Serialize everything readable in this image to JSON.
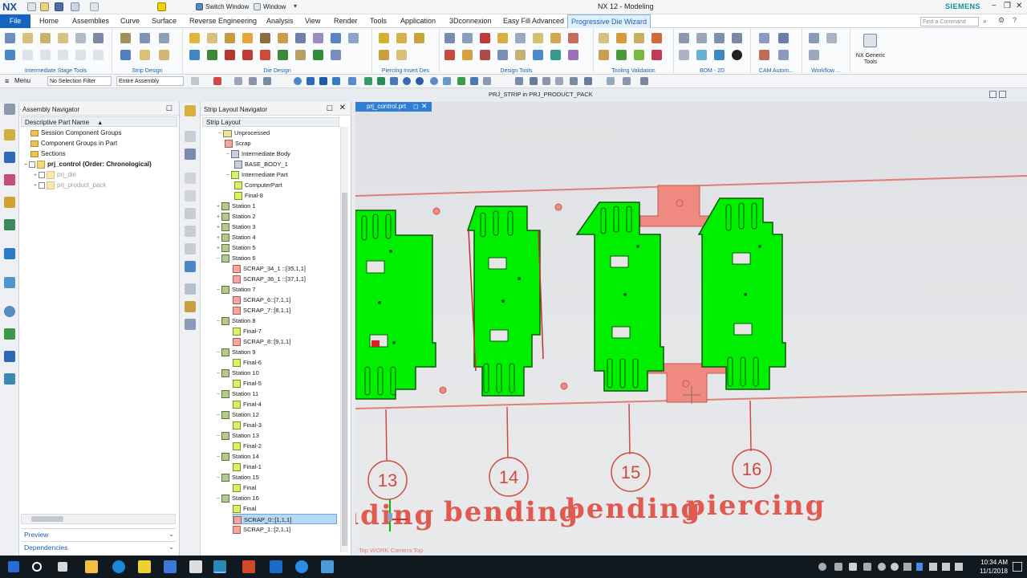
{
  "titlebar": {
    "app_title": "NX 12 - Modeling",
    "brand": "SIEMENS",
    "switch_window": "Switch Window",
    "window_menu": "Window"
  },
  "menubar": {
    "file": "File",
    "tabs": [
      "Home",
      "Assemblies",
      "Curve",
      "Surface",
      "Reverse Engineering",
      "Analysis",
      "View",
      "Render",
      "Tools",
      "Application",
      "3Dconnexion",
      "Easy Fill Advanced",
      "Progressive Die Wizard"
    ],
    "search_placeholder": "Find a Command"
  },
  "ribbon": {
    "groups": [
      "Intermediate Stage Tools",
      "Strip Design",
      "Die Design",
      "Piercing Insert Des",
      "Design Tools",
      "Tooling Validation",
      "BOM - 2D",
      "CAM Autom...",
      "Workflow ...",
      "NX Generic Tools"
    ]
  },
  "cmdbar": {
    "menu": "Menu",
    "selection_filter": "No Selection Filter",
    "scope": "Entire Assembly"
  },
  "assembly_nav": {
    "title": "Assembly Navigator",
    "column": "Descriptive Part Name",
    "rows": [
      "Session Component Groups",
      "Component Groups in Part",
      "Sections",
      "prj_control (Order: Chronological)",
      "prj_die",
      "prj_product_pack"
    ],
    "preview": "Preview",
    "dependencies": "Dependencies"
  },
  "strip_nav": {
    "title": "Strip Layout Navigator",
    "root": "Strip Layout",
    "rows": [
      "Unprocessed",
      "Scrap",
      "Intermediate Body",
      "BASE_BODY_1",
      "Intermediate Part",
      "ComputerPart",
      "Final-8",
      "Station 1",
      "Station 2",
      "Station 3",
      "Station 4",
      "Station 5",
      "Station 6",
      "SCRAP_34_1 ::[35,1,1]",
      "SCRAP_36_1 ::[37,1,1]",
      "Station 7",
      "SCRAP_6::[7,1,1]",
      "SCRAP_7::[8,1,1]",
      "Station 8",
      "Final-7",
      "SCRAP_8::[9,1,1]",
      "Station 9",
      "Final-6",
      "Station 10",
      "Final-5",
      "Station 11",
      "Final-4",
      "Station 12",
      "Final-3",
      "Station 13",
      "Final-2",
      "Station 14",
      "Final-1",
      "Station 15",
      "Final",
      "Station 16",
      "Final",
      "SCRAP_0::[1,1,1]",
      "SCRAP_1::[2,1,1]"
    ]
  },
  "viewport": {
    "tab": "prj_control.prt",
    "header": "PRJ_STRIP in PRJ_PRODUCT_PACK",
    "camera": "Top WORK Camera Top",
    "stations": [
      "13",
      "14",
      "15",
      "16"
    ],
    "ops": [
      "bending",
      "bending",
      "bending",
      "piercing"
    ]
  },
  "taskbar": {
    "time": "10:34 AM",
    "date": "11/1/2018"
  }
}
